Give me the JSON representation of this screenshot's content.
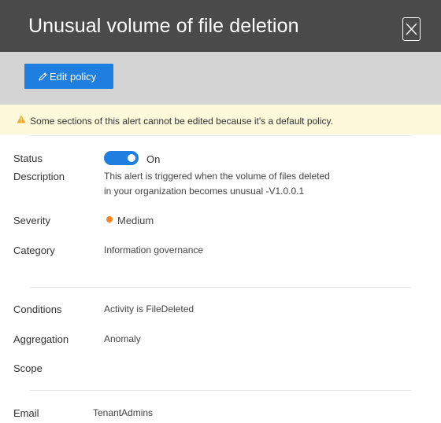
{
  "panel": {
    "title": "Unusual volume of file deletion",
    "close_icon": "close-icon"
  },
  "toolbar": {
    "edit_label": "Edit policy",
    "edit_icon": "pencil-icon"
  },
  "warning": {
    "icon": "warning-icon",
    "text": "Some sections of this alert cannot be edited because it's a default policy."
  },
  "details": {
    "status": {
      "label": "Status",
      "value": "On",
      "enabled": true
    },
    "description": {
      "label": "Description",
      "lines": [
        "This alert is triggered when the volume of files deleted",
        "in your organization becomes unusual -V1.0.0.1"
      ]
    },
    "severity": {
      "label": "Severity",
      "value": "Medium"
    },
    "category": {
      "label": "Category",
      "value": "Information governance"
    },
    "conditions": {
      "label": "Conditions",
      "value": "Activity is FileDeleted"
    },
    "aggregation": {
      "label": "Aggregation",
      "value": "Anomaly"
    },
    "scope": {
      "label": "Scope",
      "value": ""
    },
    "email": {
      "label": "Email",
      "value": "TenantAdmins"
    }
  },
  "colors": {
    "header_bg": "#4a4a4a",
    "toolbar_bg": "#d4d4d4",
    "accent": "#1e7fe0",
    "warning_bg": "#fef9db",
    "warning_icon": "#f5a623",
    "severity_medium": "#f5851f"
  }
}
